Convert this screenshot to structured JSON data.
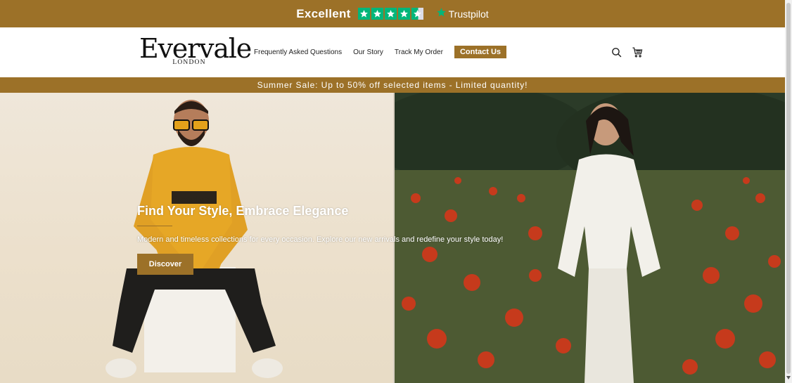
{
  "trustpilot": {
    "rating_label": "Excellent",
    "stars": 4.5,
    "brand": "Trustpilot",
    "star_color": "#00b67a"
  },
  "header": {
    "logo_word": "Evervale",
    "logo_sub": "LONDON",
    "nav": [
      {
        "label": "Frequently Asked Questions"
      },
      {
        "label": "Our Story"
      },
      {
        "label": "Track My Order"
      }
    ],
    "contact_label": "Contact Us",
    "icons": [
      "search-icon",
      "cart-icon"
    ]
  },
  "sale_banner": {
    "text": "Summer Sale: Up to 50% off selected items - Limited quantity!"
  },
  "hero": {
    "title": "Find Your Style, Embrace Elegance",
    "description": "Modern and timeless collections for every occasion. Explore our new arrivals and redefine your style today!",
    "button_label": "Discover",
    "left_image_alt": "man in yellow freedom sweatshirt sitting on white cube",
    "right_image_alt": "woman in white outfit walking through poppy field"
  },
  "colors": {
    "accent": "#9c7128",
    "white": "#ffffff",
    "text_dark": "#222222"
  }
}
